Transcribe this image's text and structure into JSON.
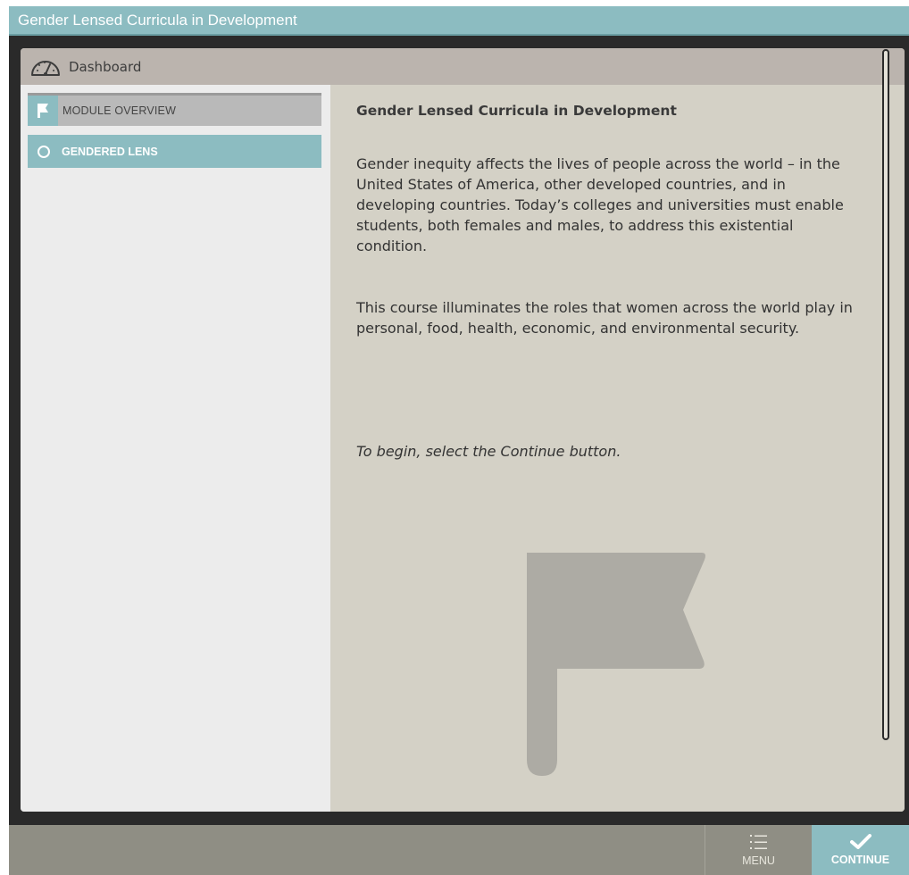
{
  "window": {
    "title": "Gender Lensed Curricula in Development"
  },
  "dashboard": {
    "label": "Dashboard",
    "icon": "speedometer-icon"
  },
  "sidebar": {
    "items": [
      {
        "label": "MODULE OVERVIEW",
        "icon": "flag-icon",
        "state": "visited"
      },
      {
        "label": "GENDERED LENS",
        "icon": "circle-icon",
        "state": "available"
      }
    ]
  },
  "content": {
    "title": "Gender Lensed Curricula in Development",
    "paragraph1": "Gender inequity affects the lives of people across the world – in the United States of America, other developed countries, and in developing countries. Today’s colleges and universities must enable students, both females and males, to address this existential condition.",
    "paragraph2": "This course illuminates the roles that women across the world play in personal, food, health, economic, and environmental security.",
    "instruction": "To begin, select the Continue button.",
    "graphic": "flag-icon"
  },
  "footer": {
    "menu_label": "MENU",
    "continue_label": "CONTINUE"
  },
  "colors": {
    "accent": "#8cbcc1",
    "content_bg": "#d4d1c6",
    "sidebar_bg": "#ececec",
    "footer_bg": "#8f8e84"
  }
}
